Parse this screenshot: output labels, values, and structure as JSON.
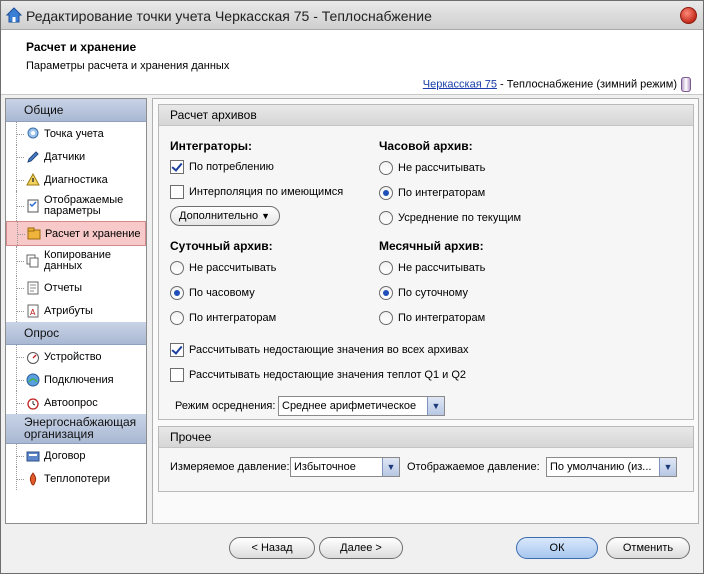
{
  "window": {
    "title": "Редактирование точки учета Черкасская 75 - Теплоснабжение",
    "app_icon": "home-icon",
    "close_icon": "close-icon"
  },
  "header": {
    "title": "Расчет и хранение",
    "subtitle": "Параметры расчета и хранения данных",
    "crumb_link": "Черкасская 75",
    "crumb_rest": " - Теплоснабжение (зимний режим)",
    "crumb_icon": "thermometer-icon"
  },
  "sidebar": {
    "sections": [
      {
        "label": "Общие",
        "items": [
          {
            "label": "Точка учета",
            "icon": "pin-icon"
          },
          {
            "label": "Датчики",
            "icon": "pencil-icon"
          },
          {
            "label": "Диагностика",
            "icon": "diagnostics-icon"
          },
          {
            "label": "Отображаемые параметры",
            "icon": "checklist-icon"
          },
          {
            "label": "Расчет и хранение",
            "icon": "storage-icon",
            "active": true
          },
          {
            "label": "Копирование данных",
            "icon": "copy-icon"
          },
          {
            "label": "Отчеты",
            "icon": "report-icon"
          },
          {
            "label": "Атрибуты",
            "icon": "attributes-icon"
          }
        ]
      },
      {
        "label": "Опрос",
        "items": [
          {
            "label": "Устройство",
            "icon": "gauge-icon"
          },
          {
            "label": "Подключения",
            "icon": "connection-icon"
          },
          {
            "label": "Автоопрос",
            "icon": "alarm-clock-icon"
          }
        ]
      },
      {
        "label": "Энергоснабжающая организация",
        "items": [
          {
            "label": "Договор",
            "icon": "contract-icon"
          },
          {
            "label": "Теплопотери",
            "icon": "heatloss-icon"
          }
        ]
      }
    ]
  },
  "archives": {
    "title": "Расчет архивов",
    "integrators": {
      "label": "Интеграторы:",
      "by_consumption": "По потреблению",
      "by_consumption_checked": true,
      "interpolation": "Интерполяция по имеющимся",
      "interpolation_checked": false,
      "extra_button": "Дополнительно"
    },
    "hourly": {
      "label": "Часовой архив:",
      "options": [
        "Не рассчитывать",
        "По интеграторам",
        "Усреднение по текущим"
      ],
      "selected": 1
    },
    "daily": {
      "label": "Суточный архив:",
      "options": [
        "Не рассчитывать",
        "По часовому",
        "По интеграторам"
      ],
      "selected": 1
    },
    "monthly": {
      "label": "Месячный архив:",
      "options": [
        "Не рассчитывать",
        "По суточному",
        "По интеграторам"
      ],
      "selected": 1
    },
    "calc_missing": {
      "label": "Рассчитывать недостающие значения во всех архивах",
      "checked": true
    },
    "calc_missing_q": {
      "label": "Рассчитывать недостающие значения теплот Q1 и Q2",
      "checked": false
    },
    "averaging": {
      "label": "Режим осреднения:",
      "value": "Среднее арифметическое"
    }
  },
  "other": {
    "title": "Прочее",
    "measured_pressure": {
      "label": "Измеряемое давление:",
      "value": "Избыточное"
    },
    "displayed_pressure": {
      "label": "Отображаемое давление:",
      "value": "По умолчанию (из..."
    }
  },
  "footer": {
    "back": "< Назад",
    "next": "Далее >",
    "ok": "ОК",
    "cancel": "Отменить"
  },
  "colors": {
    "active_item": "#f7c9c9",
    "section_header": "#b6c3dc",
    "radio_dot": "#1f4fb8"
  }
}
